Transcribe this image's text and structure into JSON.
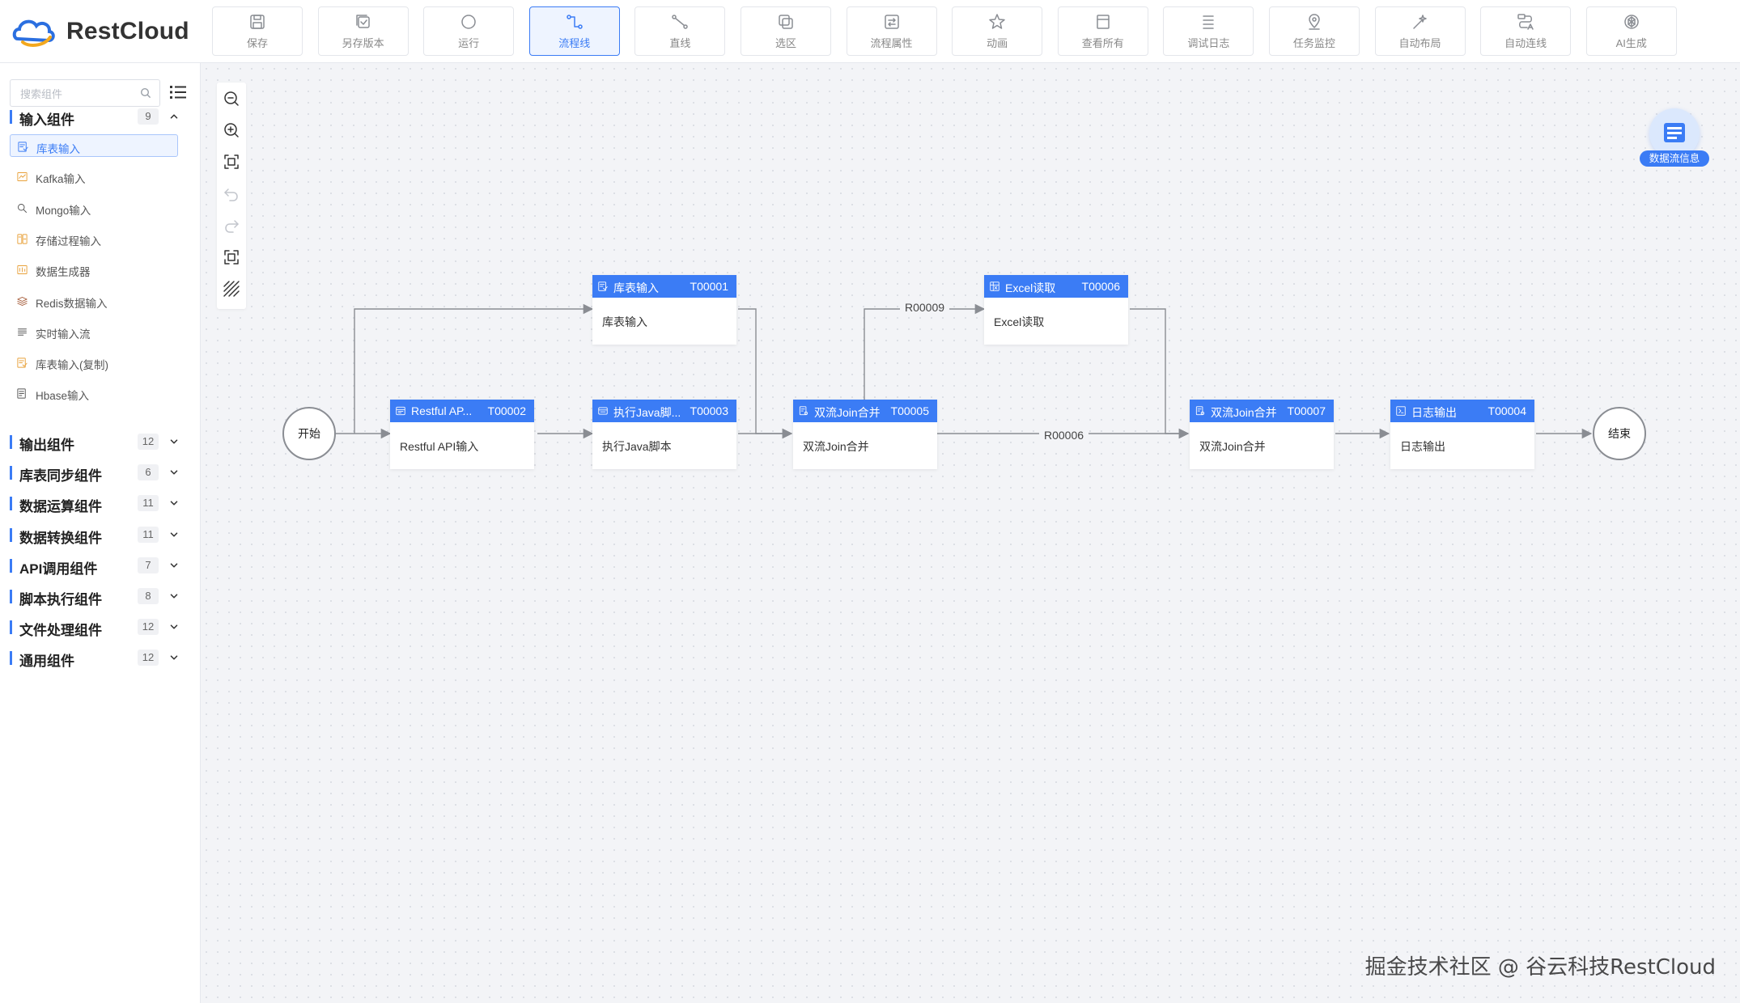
{
  "app": {
    "brand": "RestCloud"
  },
  "toolbar": [
    {
      "id": "save",
      "label": "保存",
      "icon": "save-icon",
      "active": false
    },
    {
      "id": "save-version",
      "label": "另存版本",
      "icon": "save-version-icon",
      "active": false
    },
    {
      "id": "run",
      "label": "运行",
      "icon": "run-icon",
      "active": false
    },
    {
      "id": "flowline",
      "label": "流程线",
      "icon": "flowline-icon",
      "active": true
    },
    {
      "id": "straight-line",
      "label": "直线",
      "icon": "straight-line-icon",
      "active": false
    },
    {
      "id": "select-area",
      "label": "选区",
      "icon": "select-area-icon",
      "active": false
    },
    {
      "id": "process-props",
      "label": "流程属性",
      "icon": "process-props-icon",
      "active": false
    },
    {
      "id": "animation",
      "label": "动画",
      "icon": "animation-icon",
      "active": false
    },
    {
      "id": "view-all",
      "label": "查看所有",
      "icon": "view-all-icon",
      "active": false
    },
    {
      "id": "debug-log",
      "label": "调试日志",
      "icon": "debug-log-icon",
      "active": false
    },
    {
      "id": "task-monitor",
      "label": "任务监控",
      "icon": "task-monitor-icon",
      "active": false
    },
    {
      "id": "auto-layout",
      "label": "自动布局",
      "icon": "auto-layout-icon",
      "active": false
    },
    {
      "id": "auto-connect",
      "label": "自动连线",
      "icon": "auto-connect-icon",
      "active": false
    },
    {
      "id": "ai-generate",
      "label": "AI生成",
      "icon": "ai-generate-icon",
      "active": false
    }
  ],
  "sidebar": {
    "search_placeholder": "搜索组件",
    "input_category": {
      "name": "输入组件",
      "count": "9",
      "expanded": true
    },
    "input_items": [
      {
        "label": "库表输入",
        "icon": "table-input-icon",
        "selected": true
      },
      {
        "label": "Kafka输入",
        "icon": "kafka-icon",
        "selected": false
      },
      {
        "label": "Mongo输入",
        "icon": "mongo-icon",
        "selected": false
      },
      {
        "label": "存储过程输入",
        "icon": "procedure-icon",
        "selected": false
      },
      {
        "label": "数据生成器",
        "icon": "data-generator-icon",
        "selected": false
      },
      {
        "label": "Redis数据输入",
        "icon": "redis-icon",
        "selected": false
      },
      {
        "label": "实时输入流",
        "icon": "realtime-stream-icon",
        "selected": false
      },
      {
        "label": "库表输入(复制)",
        "icon": "table-input-copy-icon",
        "selected": false
      },
      {
        "label": "Hbase输入",
        "icon": "hbase-icon",
        "selected": false
      }
    ],
    "categories": [
      {
        "name": "输出组件",
        "count": "12"
      },
      {
        "name": "库表同步组件",
        "count": "6"
      },
      {
        "name": "数据运算组件",
        "count": "11"
      },
      {
        "name": "数据转换组件",
        "count": "11"
      },
      {
        "name": "API调用组件",
        "count": "7"
      },
      {
        "name": "脚本执行组件",
        "count": "8"
      },
      {
        "name": "文件处理组件",
        "count": "12"
      },
      {
        "name": "通用组件",
        "count": "12"
      }
    ]
  },
  "canvas_tools": [
    "zoom-out-icon",
    "zoom-in-icon",
    "fit-view-icon",
    "undo-icon",
    "redo-icon",
    "full-screen-icon",
    "grid-toggle-icon"
  ],
  "flow": {
    "start_label": "开始",
    "end_label": "结束",
    "nodes": [
      {
        "key": "n1",
        "title": "库表输入",
        "id": "T00001",
        "body": "库表输入",
        "icon": "table-input-icon"
      },
      {
        "key": "n2",
        "title": "Restful AP...",
        "id": "T00002",
        "body": "Restful API输入",
        "icon": "restful-icon"
      },
      {
        "key": "n3",
        "title": "执行Java脚...",
        "id": "T00003",
        "body": "执行Java脚本",
        "icon": "java-script-icon"
      },
      {
        "key": "n5",
        "title": "双流Join合并",
        "id": "T00005",
        "body": "双流Join合并",
        "icon": "join-icon"
      },
      {
        "key": "n6",
        "title": "Excel读取",
        "id": "T00006",
        "body": "Excel读取",
        "icon": "excel-icon"
      },
      {
        "key": "n7",
        "title": "双流Join合并",
        "id": "T00007",
        "body": "双流Join合并",
        "icon": "join-icon"
      },
      {
        "key": "n4",
        "title": "日志输出",
        "id": "T00004",
        "body": "日志输出",
        "icon": "log-output-icon"
      }
    ],
    "edge_labels": [
      {
        "key": "e1",
        "text": "R00009"
      },
      {
        "key": "e2",
        "text": "R00006"
      }
    ],
    "flow_info_label": "数据流信息"
  },
  "watermark": "掘金技术社区 @ 谷云科技RestCloud",
  "colors": {
    "accent": "#3b7cf5",
    "edge": "#8a8d93"
  }
}
